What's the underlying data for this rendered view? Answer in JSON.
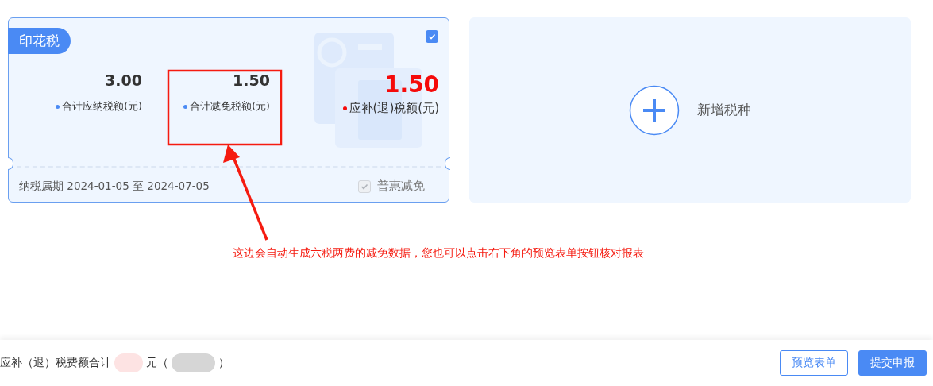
{
  "tax_card": {
    "tag": "印花税",
    "checked": true,
    "stats": [
      {
        "value": "3.00",
        "label": "合计应纳税额(元)",
        "kind": "normal"
      },
      {
        "value": "1.50",
        "label": "合计减免税额(元)",
        "kind": "normal"
      },
      {
        "value": "1.50",
        "label": "应补(退)税额(元)",
        "kind": "highlight"
      }
    ],
    "period": "纳税属期 2024-01-05 至 2024-07-05",
    "relief": {
      "label": "普惠减免",
      "checked": true,
      "disabled": true
    }
  },
  "add_card": {
    "label": "新增税种"
  },
  "annotation": {
    "text": "这边会自动生成六税两费的减免数据，您也可以点击右下角的预览表单按钮核对报表"
  },
  "footer": {
    "summary_label": "应补（退）税费额合计",
    "unit": "元",
    "paren_open": "（",
    "paren_close": "）",
    "buttons": [
      {
        "label": "预览表单",
        "kind": "secondary"
      },
      {
        "label": "提交申报",
        "kind": "primary"
      }
    ]
  }
}
